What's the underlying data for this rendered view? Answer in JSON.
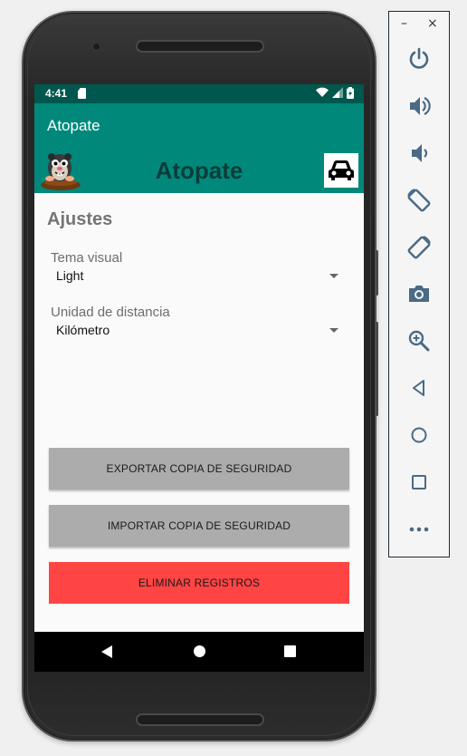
{
  "status_bar": {
    "time": "4:41"
  },
  "app_bar": {
    "title": "Atopate"
  },
  "banner": {
    "title": "Atopate"
  },
  "settings": {
    "section_title": "Ajustes",
    "theme": {
      "label": "Tema visual",
      "value": "Light"
    },
    "distance": {
      "label": "Unidad de distancia",
      "value": "Kilómetro"
    }
  },
  "buttons": {
    "export_label": "EXPORTAR COPIA DE SEGURIDAD",
    "import_label": "IMPORTAR COPIA DE SEGURIDAD",
    "delete_label": "ELIMINAR REGISTROS"
  },
  "emulator": {
    "minimize": "–",
    "close": "×",
    "tools": [
      "power-icon",
      "volume-up-icon",
      "volume-down-icon",
      "rotate-left-icon",
      "rotate-right-icon",
      "camera-icon",
      "zoom-icon",
      "back-icon",
      "home-icon",
      "overview-icon",
      "more-icon"
    ]
  },
  "colors": {
    "primary": "#00897b",
    "primary_dark": "#00574d",
    "button_grey": "#acacac",
    "button_red": "#ff4444",
    "toolbar_icon": "#4a6a85"
  }
}
